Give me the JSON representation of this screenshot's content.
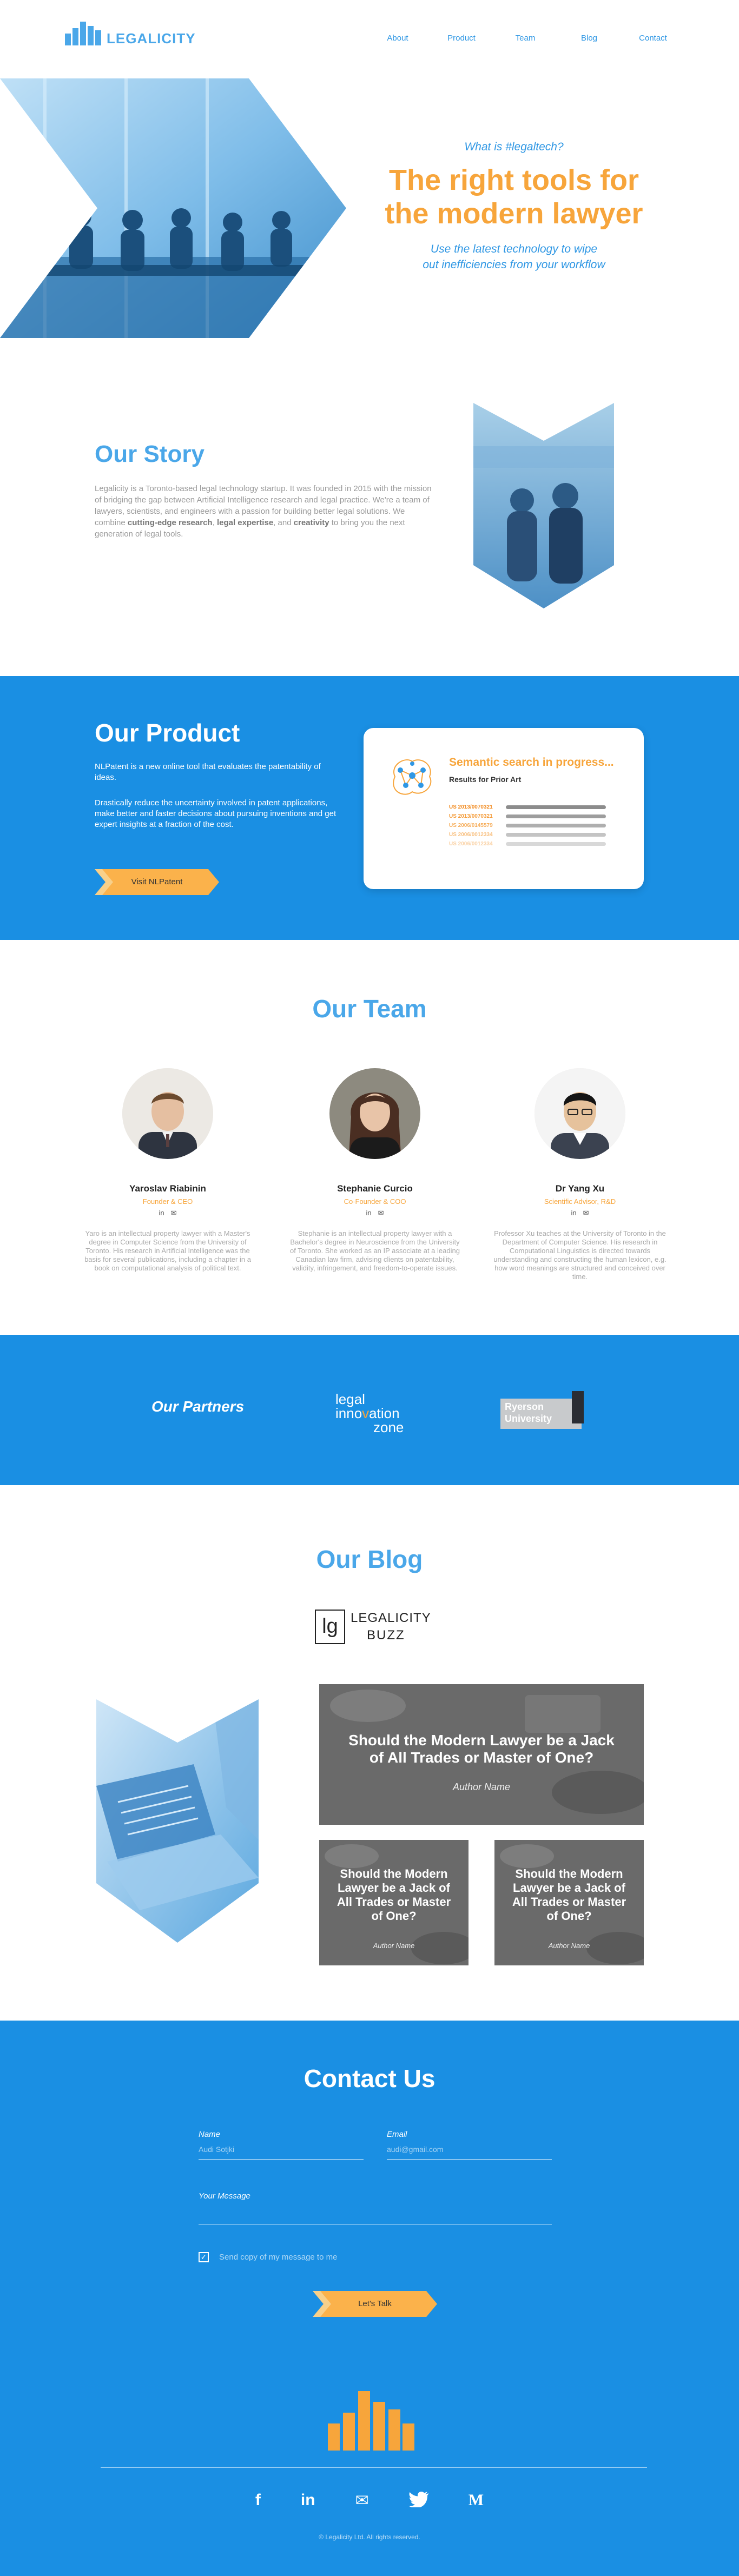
{
  "brand": {
    "logo_text": "LEGALICITY",
    "accent": "#2f97e4",
    "orange": "#f7a53b",
    "blue_section": "#1a8fe3"
  },
  "nav": {
    "items": [
      "About",
      "Product",
      "Team",
      "Blog",
      "Contact"
    ]
  },
  "hero": {
    "eyebrow": "What is #legaltech?",
    "title_line1": "The right tools for",
    "title_line2": "the modern lawyer",
    "sub_line1": "Use the latest technology to wipe",
    "sub_line2": "out inefficiencies from your workflow"
  },
  "story": {
    "title": "Our Story",
    "p_a": "Legalicity is a Toronto-based legal technology startup. It was founded in 2015 with the mission of bridging the gap between Artificial Intelligence research and legal practice. We're a team of lawyers, scientists, and engineers with a passion for building better legal solutions. We combine ",
    "b1": "cutting-edge research",
    "p_b": ", ",
    "b2": "legal expertise",
    "p_c": ", and ",
    "b3": "creativity",
    "p_d": " to bring you the next generation of legal tools."
  },
  "product": {
    "title": "Our Product",
    "p1": "NLPatent is a new online tool that evaluates the patentability of ideas.",
    "p2": "Drastically reduce the uncertainty involved in patent applications, make better and faster decisions about pursuing inventions and get expert insights at a fraction of the cost.",
    "button": "Visit NLPatent",
    "card_title": "Semantic search in progress...",
    "card_sub": "Results for Prior Art",
    "results": [
      "US 2013/0070321",
      "US 2013/0070321",
      "US 2006/0145579",
      "US 2006/0012334",
      "US 2006/0012334"
    ]
  },
  "team": {
    "title": "Our Team",
    "members": [
      {
        "name": "Yaroslav Riabinin",
        "role": "Founder & CEO",
        "bio": "Yaro is an intellectual property lawyer with a Master's degree in Computer Science from the University of Toronto. His research in Artificial Intelligence was the basis for several publications, including a chapter in a book on computational analysis of political text."
      },
      {
        "name": "Stephanie Curcio",
        "role": "Co-Founder & COO",
        "bio": "Stephanie is an intellectual property lawyer with a Bachelor's degree in Neuroscience from the University of Toronto. She worked as an IP associate at a leading Canadian law firm, advising clients on patentability, validity, infringement, and freedom-to-operate issues."
      },
      {
        "name": "Dr Yang Xu",
        "role": "Scientific Advisor, R&D",
        "bio": "Professor Xu teaches at the University of Toronto in the Department of Computer Science. His research in Computational Linguistics is directed towards understanding and constructing the human lexicon, e.g. how word meanings are structured and conceived over time."
      }
    ],
    "icons": [
      "in",
      "✉"
    ]
  },
  "partners": {
    "title": "Our Partners",
    "lio_line1": "legal",
    "lio_line2a": "inno",
    "lio_line2b": "ation",
    "lio_line3": "zone",
    "ryerson_line1": "Ryerson",
    "ryerson_line2": "University"
  },
  "blog": {
    "title": "Our Blog",
    "buzz_word1": "LEGALICITY",
    "buzz_word2": "BUZZ",
    "buzz_mark": "lg",
    "posts": [
      {
        "title_l1": "Should the Modern Lawyer be a Jack",
        "title_l2": "of All Trades or Master of One?",
        "author": "Author Name"
      },
      {
        "title_l1": "Should the Modern",
        "title_l2": "Lawyer be a Jack of",
        "title_l3": "All Trades or Master",
        "title_l4": "of One?",
        "author": "Author Name"
      },
      {
        "title_l1": "Should the Modern",
        "title_l2": "Lawyer be a Jack of",
        "title_l3": "All Trades or Master",
        "title_l4": "of One?",
        "author": "Author Name"
      }
    ]
  },
  "contact": {
    "title": "Contact Us",
    "name_label": "Name",
    "name_value": "Audi Sotjki",
    "email_label": "Email",
    "email_value": "audi@gmail.com",
    "message_label": "Your Message",
    "checkbox_label": "Send copy of my message to me",
    "checkbox_checked": true,
    "submit": "Let's Talk",
    "copyright": "© Legalicity Ltd. All rights reserved."
  },
  "footer": {
    "socials": [
      "facebook-icon",
      "linkedin-icon",
      "mail-icon",
      "twitter-icon",
      "medium-icon"
    ]
  }
}
